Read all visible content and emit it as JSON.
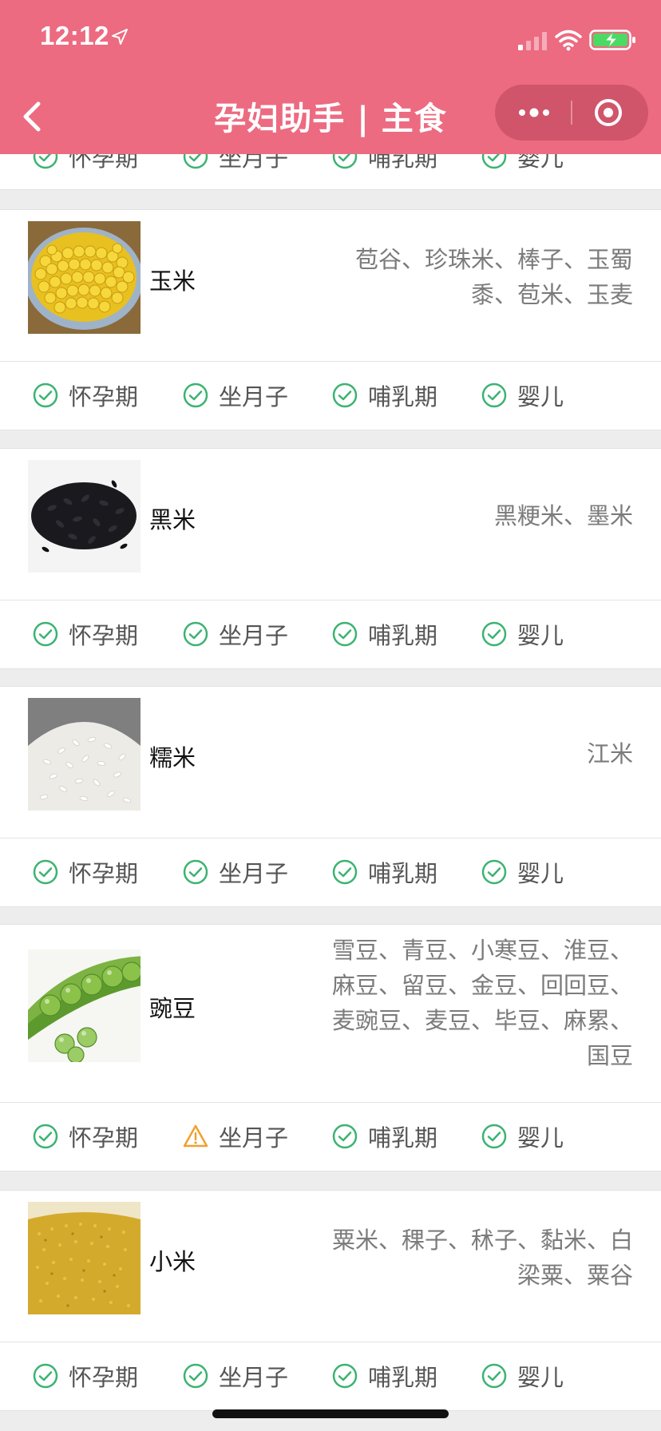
{
  "status_bar": {
    "time": "12:12"
  },
  "nav": {
    "title": "孕妇助手 | 主食"
  },
  "tag_labels": [
    "怀孕期",
    "坐月子",
    "哺乳期",
    "婴儿"
  ],
  "partial_card": {
    "tags": [
      {
        "label": "怀孕期",
        "status": "ok"
      },
      {
        "label": "坐月子",
        "status": "ok"
      },
      {
        "label": "哺乳期",
        "status": "ok"
      },
      {
        "label": "婴儿",
        "status": "ok"
      }
    ]
  },
  "foods": [
    {
      "name": "玉米",
      "aliases": "苞谷、珍珠米、棒子、玉蜀黍、苞米、玉麦",
      "image": "corn",
      "tags": [
        {
          "label": "怀孕期",
          "status": "ok"
        },
        {
          "label": "坐月子",
          "status": "ok"
        },
        {
          "label": "哺乳期",
          "status": "ok"
        },
        {
          "label": "婴儿",
          "status": "ok"
        }
      ]
    },
    {
      "name": "黑米",
      "aliases": "黑粳米、墨米",
      "image": "black-rice",
      "tags": [
        {
          "label": "怀孕期",
          "status": "ok"
        },
        {
          "label": "坐月子",
          "status": "ok"
        },
        {
          "label": "哺乳期",
          "status": "ok"
        },
        {
          "label": "婴儿",
          "status": "ok"
        }
      ]
    },
    {
      "name": "糯米",
      "aliases": "江米",
      "image": "glutinous-rice",
      "tags": [
        {
          "label": "怀孕期",
          "status": "ok"
        },
        {
          "label": "坐月子",
          "status": "ok"
        },
        {
          "label": "哺乳期",
          "status": "ok"
        },
        {
          "label": "婴儿",
          "status": "ok"
        }
      ]
    },
    {
      "name": "豌豆",
      "aliases": "雪豆、青豆、小寒豆、淮豆、麻豆、留豆、金豆、回回豆、麦豌豆、麦豆、毕豆、麻累、国豆",
      "image": "pea",
      "tags": [
        {
          "label": "怀孕期",
          "status": "ok"
        },
        {
          "label": "坐月子",
          "status": "caution"
        },
        {
          "label": "哺乳期",
          "status": "ok"
        },
        {
          "label": "婴儿",
          "status": "ok"
        }
      ]
    },
    {
      "name": "小米",
      "aliases": "粟米、稞子、秫子、黏米、白梁粟、粟谷",
      "image": "millet",
      "tags": [
        {
          "label": "怀孕期",
          "status": "ok"
        },
        {
          "label": "坐月子",
          "status": "ok"
        },
        {
          "label": "哺乳期",
          "status": "ok"
        },
        {
          "label": "婴儿",
          "status": "ok"
        }
      ]
    }
  ],
  "colors": {
    "header": "#ec6b81",
    "ok": "#3cb371",
    "caution": "#f0a030",
    "alias_text": "#7b7b7b"
  }
}
